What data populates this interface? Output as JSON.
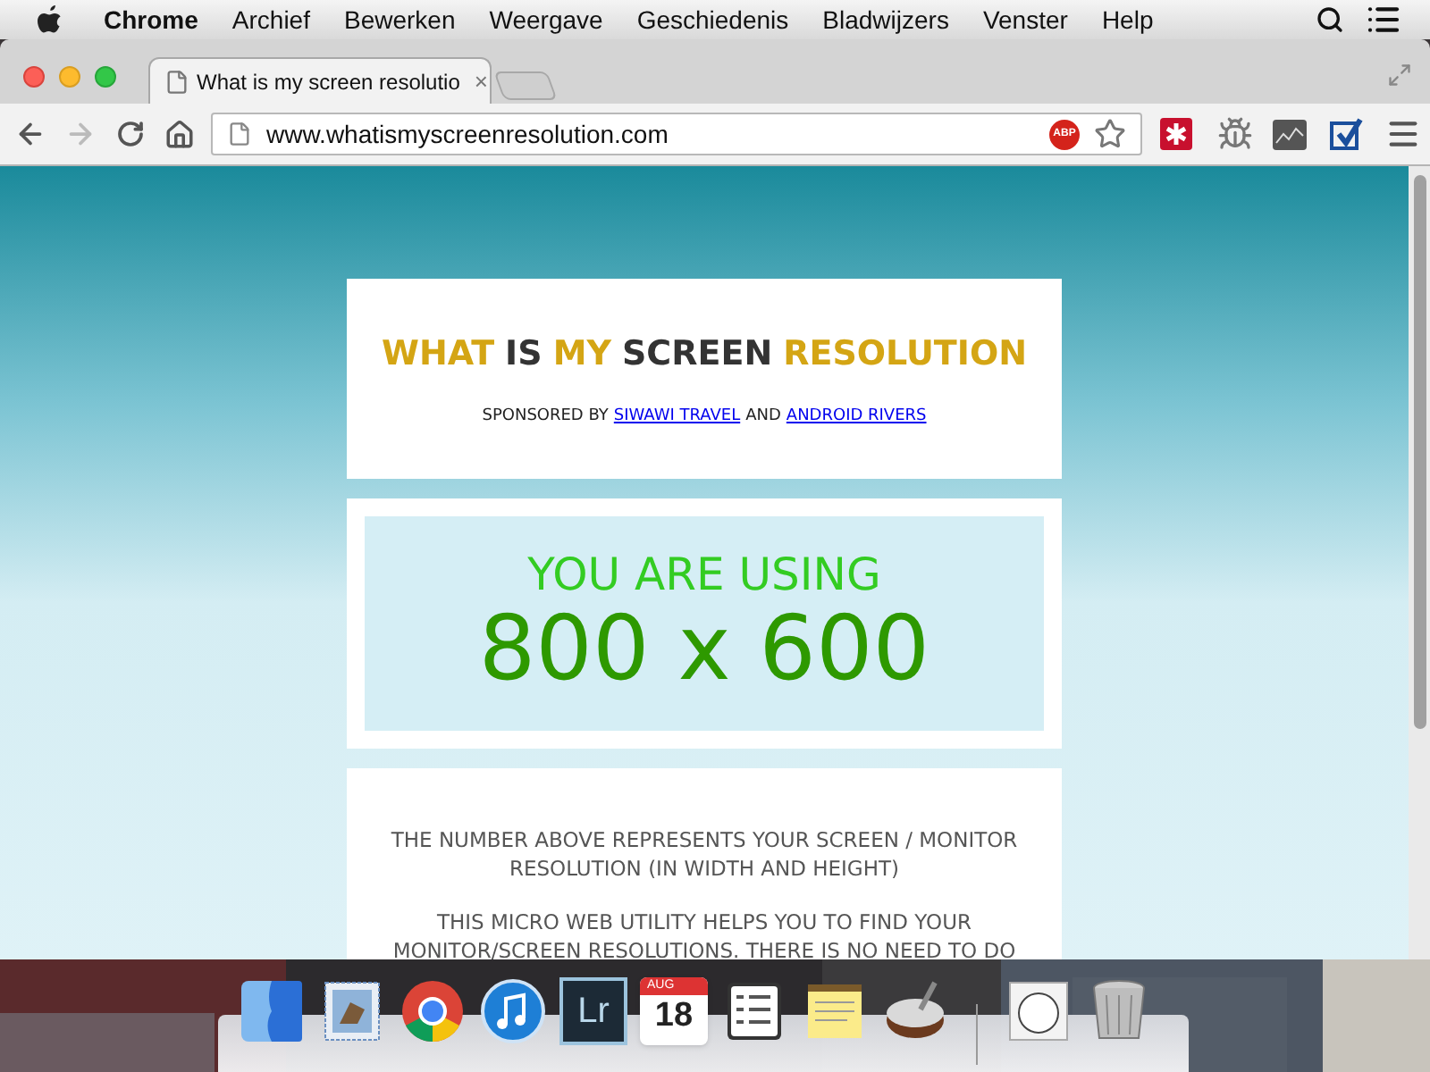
{
  "menu_bar": {
    "app_name": "Chrome",
    "menus": [
      "Archief",
      "Bewerken",
      "Weergave",
      "Geschiedenis",
      "Bladwijzers",
      "Venster",
      "Help"
    ]
  },
  "tabs": [
    {
      "title": "What is my screen resolutio",
      "close": "×",
      "selected": true
    }
  ],
  "toolbar": {
    "back": {
      "disabled": false
    },
    "forward": {
      "disabled": true
    },
    "address": "www.whatismyscreenresolution.com",
    "adblock_badge": "ABP"
  },
  "page": {
    "title_words": [
      {
        "text": "WHAT",
        "color": "#d4a514"
      },
      {
        "text": "IS",
        "color": "#333333"
      },
      {
        "text": "MY",
        "color": "#d4a514"
      },
      {
        "text": "SCREEN",
        "color": "#333333"
      },
      {
        "text": "RESOLUTION",
        "color": "#d4a514"
      }
    ],
    "sponsor": {
      "prefix": "SPONSORED BY",
      "link_1": "SIWAWI TRAVEL",
      "middle": "AND",
      "link_2": "ANDROID RIVERS"
    },
    "using_label": "YOU ARE USING",
    "resolution": "800 x 600",
    "paragraphs": [
      "THE NUMBER ABOVE REPRESENTS YOUR SCREEN / MONITOR RESOLUTION (IN WIDTH AND HEIGHT)",
      "THIS MICRO WEB UTILITY HELPS YOU TO FIND YOUR MONITOR/SCREEN RESOLUTIONS. THERE IS NO NEED TO DO"
    ]
  },
  "dock": [
    {
      "kind": "finder"
    },
    {
      "kind": "mail"
    },
    {
      "kind": "chrome"
    },
    {
      "kind": "music"
    },
    {
      "kind": "lightroom",
      "text": "Lr"
    },
    {
      "kind": "calendar",
      "month": "AUG",
      "day": "18"
    },
    {
      "kind": "reminders"
    },
    {
      "kind": "notes"
    },
    {
      "kind": "cake"
    },
    {
      "kind": "separator"
    },
    {
      "kind": "comic"
    },
    {
      "kind": "trash"
    }
  ]
}
